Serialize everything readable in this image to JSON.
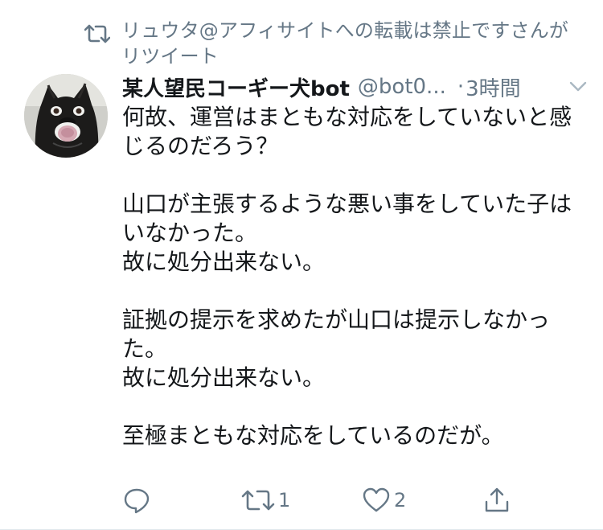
{
  "retweet": {
    "icon": "retweet-icon",
    "text": "リュウタ@アフィサイトへの転載は禁止ですさんがリツイート"
  },
  "tweet": {
    "avatar_icon": "dog-avatar",
    "display_name": "某人望民コーギー犬bot",
    "handle": "@bot0...",
    "dot": "·",
    "time": "3時間",
    "caret_icon": "chevron-down-icon",
    "body": "何故、運営はまともな対応をしていないと感じるのだろう？\n\n山口が主張するような悪い事をしていた子はいなかった。\n故に処分出来ない。\n\n証拠の提示を求めたが山口は提示しなかった。\n故に処分出来ない。\n\n至極まともな対応をしているのだが。"
  },
  "actions": {
    "reply_icon": "reply-icon",
    "retweet_icon": "retweet-icon",
    "retweet_count": "1",
    "like_icon": "heart-icon",
    "like_count": "2",
    "share_icon": "share-icon"
  },
  "colors": {
    "text": "#14171a",
    "muted": "#657786",
    "divider": "#e1e8ed"
  }
}
